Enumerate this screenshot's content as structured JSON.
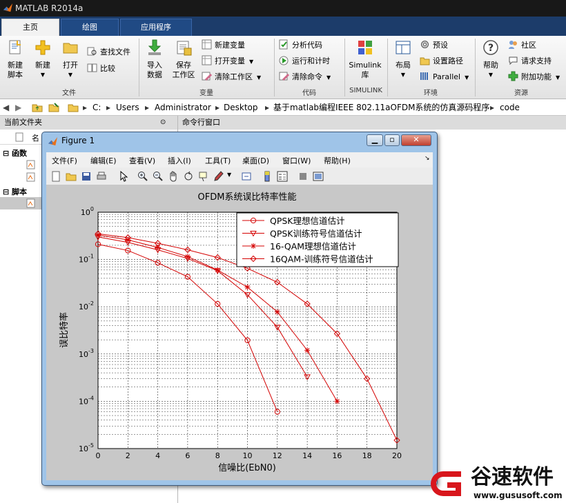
{
  "window": {
    "title": "MATLAB R2014a"
  },
  "tabs": [
    {
      "label": "主页"
    },
    {
      "label": "绘图"
    },
    {
      "label": "应用程序"
    }
  ],
  "ribbon": {
    "file": {
      "new_script": "新建\n脚本",
      "new": "新建",
      "open": "打开",
      "find_files": "查找文件",
      "compare": "比较",
      "group": "文件"
    },
    "variable": {
      "import_l1": "导入",
      "import_l2": "数据",
      "save_l1": "保存",
      "save_l2": "工作区",
      "new_var": "新建变量",
      "open_var": "打开变量",
      "clear_ws": "清除工作区",
      "group": "变量"
    },
    "code": {
      "analyze": "分析代码",
      "run_time": "运行和计时",
      "clear_cmd": "清除命令",
      "group": "代码"
    },
    "simulink": {
      "label_l1": "Simulink",
      "label_l2": "库",
      "group": "SIMULINK"
    },
    "env": {
      "layout": "布局",
      "prefs": "预设",
      "set_path": "设置路径",
      "parallel": "Parallel",
      "group": "环境"
    },
    "resources": {
      "help": "帮助",
      "community": "社区",
      "support": "请求支持",
      "addons": "附加功能",
      "group": "资源"
    }
  },
  "address": {
    "crumbs": [
      "C:",
      "Users",
      "Administrator",
      "Desktop",
      "基于matlab编程IEEE 802.11aOFDM系统的仿真源码程序",
      "code"
    ]
  },
  "panels": {
    "current_folder": "当前文件夹",
    "command_window": "命令行窗口",
    "name_col": "名",
    "functions": "函数",
    "scripts": "脚本"
  },
  "figure": {
    "title": "Figure 1",
    "menu": [
      "文件(F)",
      "编辑(E)",
      "查看(V)",
      "插入(I)",
      "工具(T)",
      "桌面(D)",
      "窗口(W)",
      "帮助(H)"
    ]
  },
  "chart_data": {
    "type": "line",
    "title": "OFDM系统误比特率性能",
    "xlabel": "信噪比(EbN0)",
    "ylabel": "误比特率",
    "x_scale": "linear",
    "y_scale": "log",
    "xlim": [
      0,
      20
    ],
    "ylim": [
      1e-05,
      1
    ],
    "xticks": [
      "0",
      "2",
      "4",
      "6",
      "8",
      "10",
      "12",
      "14",
      "16",
      "18",
      "20"
    ],
    "yticks": [
      "10^0",
      "10^-1",
      "10^-2",
      "10^-3",
      "10^-4",
      "10^-5"
    ],
    "grid": true,
    "legend_position": "top-right",
    "color": "#d40000",
    "series": [
      {
        "name": "QPSK理想信道估计",
        "marker": "circle",
        "x": [
          0,
          2,
          4,
          6,
          8,
          10,
          12
        ],
        "y": [
          0.21,
          0.155,
          0.085,
          0.043,
          0.0115,
          0.00195,
          6e-05
        ]
      },
      {
        "name": "QPSK训练符号信道估计",
        "marker": "triangle-down",
        "x": [
          0,
          2,
          4,
          6,
          8,
          10,
          12,
          14
        ],
        "y": [
          0.3,
          0.23,
          0.16,
          0.105,
          0.058,
          0.018,
          0.0037,
          0.00033
        ]
      },
      {
        "name": "16-QAM理想信道估计",
        "marker": "star",
        "x": [
          0,
          2,
          4,
          6,
          8,
          10,
          12,
          14,
          16
        ],
        "y": [
          0.33,
          0.26,
          0.18,
          0.115,
          0.06,
          0.026,
          0.0078,
          0.0012,
          0.0001
        ]
      },
      {
        "name": "16QAM-训练符号信道估计",
        "marker": "diamond",
        "x": [
          0,
          2,
          4,
          6,
          8,
          10,
          12,
          14,
          16,
          18,
          20
        ],
        "y": [
          0.35,
          0.29,
          0.22,
          0.16,
          0.11,
          0.065,
          0.033,
          0.0115,
          0.0027,
          0.0003,
          1.5e-05
        ]
      }
    ]
  },
  "watermark": {
    "brand": "谷速软件",
    "url": "www.gususoft.com"
  }
}
